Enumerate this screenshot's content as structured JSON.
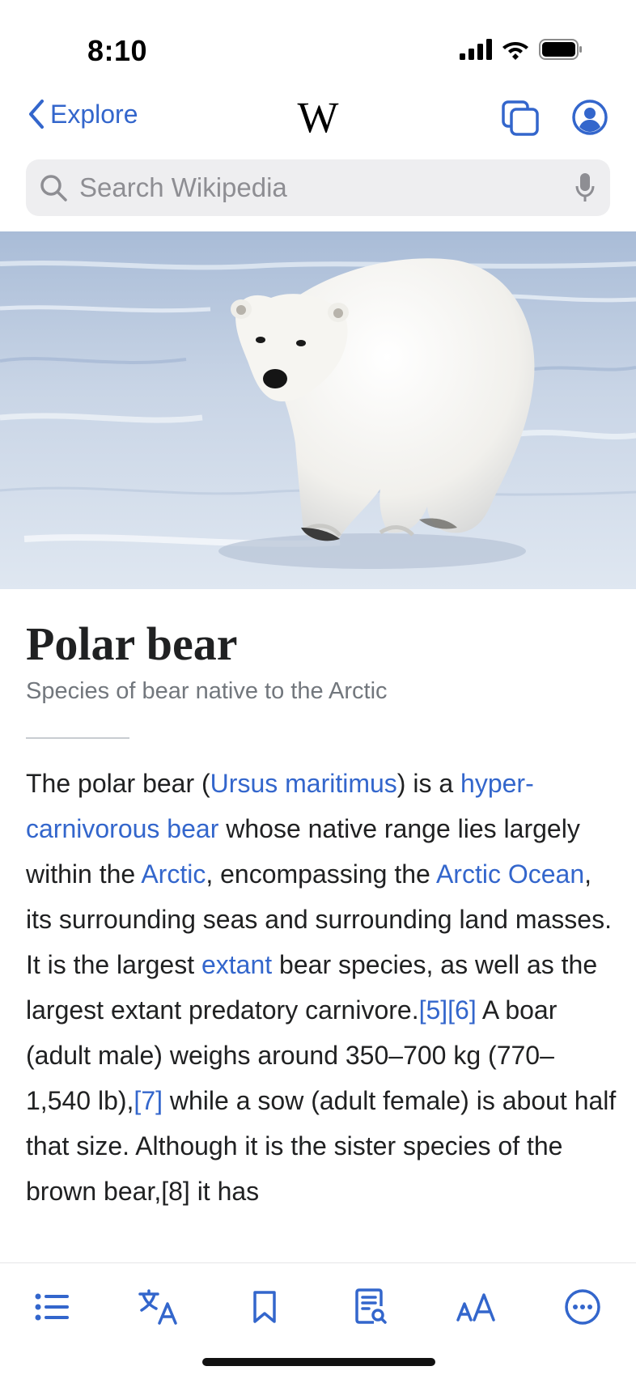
{
  "status_bar": {
    "time": "8:10"
  },
  "nav": {
    "back_label": "Explore",
    "logo": "W"
  },
  "search": {
    "placeholder": "Search Wikipedia"
  },
  "article": {
    "title": "Polar bear",
    "description": "Species of bear native to the Arctic",
    "body": [
      {
        "text": "The polar bear ("
      },
      {
        "text": "Ursus maritimus",
        "link": true
      },
      {
        "text": ") is a "
      },
      {
        "text": "hyper-carnivorous bear",
        "link": true
      },
      {
        "text": " whose native range lies largely within the "
      },
      {
        "text": "Arctic",
        "link": true
      },
      {
        "text": ", encompassing the "
      },
      {
        "text": "Arctic Ocean",
        "link": true
      },
      {
        "text": ", its surrounding seas and surrounding land masses. It is the largest "
      },
      {
        "text": "extant",
        "link": true
      },
      {
        "text": " bear species, as well as the largest extant predatory carnivore."
      },
      {
        "text": "[5]",
        "link": true
      },
      {
        "text": "[6]",
        "link": true
      },
      {
        "text": " A boar (adult male) weighs around 350–700 kg (770–1,540 lb),"
      },
      {
        "text": "[7]",
        "link": true
      },
      {
        "text": " while a sow (adult female) is about half that size. Although it is the sister species of the brown bear,[8] it has"
      }
    ]
  },
  "toolbar": {
    "icons": [
      "table-of-contents-icon",
      "languages-icon",
      "bookmark-icon",
      "find-in-page-icon",
      "text-size-icon",
      "more-icon"
    ]
  },
  "colors": {
    "accent": "#3366cc",
    "text": "#202122",
    "secondary": "#72777d"
  }
}
